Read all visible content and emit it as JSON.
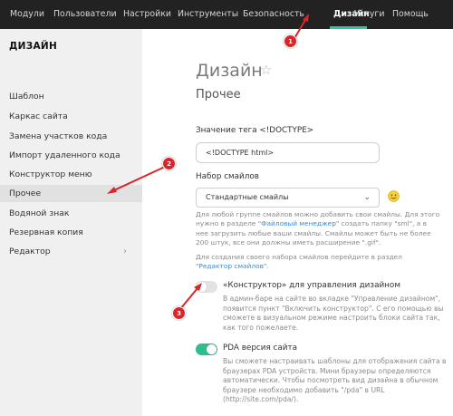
{
  "topnav": {
    "items": [
      "Модули",
      "Пользователи",
      "Настройки",
      "Инструменты",
      "Безопасность",
      "Дизайн",
      "Услуги",
      "Помощь"
    ],
    "active": "Дизайн",
    "accent_color": "#2fc7a0"
  },
  "sidebar": {
    "title": "ДИЗАЙН",
    "items": [
      {
        "label": "Шаблон"
      },
      {
        "label": "Каркас сайта"
      },
      {
        "label": "Замена участков кода"
      },
      {
        "label": "Импорт удаленного кода"
      },
      {
        "label": "Конструктор меню"
      },
      {
        "label": "Прочее"
      },
      {
        "label": "Водяной знак"
      },
      {
        "label": "Резервная копия"
      },
      {
        "label": "Редактор"
      }
    ],
    "active": "Прочее",
    "chevron": "›"
  },
  "main": {
    "title": "Дизайн",
    "star_icon": "☆",
    "section": "Прочее",
    "doctype_label": "Значение тега <!DOCTYPE>",
    "doctype_value": "<!DOCTYPE html>",
    "smiles_label": "Набор смайлов",
    "smiles_value": "Стандартные смайлы",
    "smiles_help_1": "Для любой группе смайлов можно добавить свои смайлы. Для этого нужно в разделе \"",
    "smiles_help_link": "Файловый менеджер",
    "smiles_help_2": "\" создать папку \"sml\", а в нее загрузить любые ваши смайлы. Смайлы может быть не более 200 штук, все они должны иметь расширение \".gif\".",
    "smiles_help2_1": "Для создания своего набора смайлов перейдите в раздел \"",
    "smiles_help2_link": "Редактор смайлов",
    "smiles_help2_2": "\".",
    "constructor_label": "«Конструктор» для управления дизайном",
    "constructor_enabled": false,
    "constructor_desc": "В админ-баре на сайте во вкладке \"Управление дизайном\", появится пункт \"Включить конструктор\". С его помощью вы сможете в визуальном режиме настроить блоки сайта так, как того пожелаете.",
    "pda_label": "PDA версия сайта",
    "pda_enabled": true,
    "pda_desc": "Вы сможете настраивать шаблоны для отображения сайта в браузерах PDA устройств. Мини браузеры определяются автоматически. Чтобы посмотреть вид дизайна в обычном браузере необходимо добавить \"/pda\" в URL (http://site.com/pda/).",
    "toggle_on_color": "#2dbd8f"
  },
  "markers": [
    "1",
    "2",
    "3"
  ],
  "marker_color": "#d8262a"
}
